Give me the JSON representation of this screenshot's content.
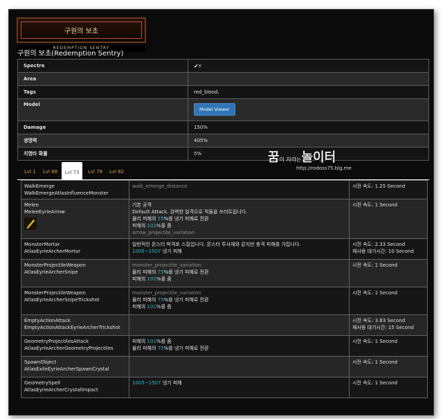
{
  "banner": {
    "title": "구원의 보초",
    "subtitle": "REDEMPTION SENTRY"
  },
  "page_title": "구원의 보초(Redemption Sentry)",
  "info_rows": [
    {
      "key": "Spectre",
      "value": "Y",
      "check": "✔"
    },
    {
      "key": "Area",
      "value": ""
    },
    {
      "key": "Tags",
      "value": "red_blood,"
    },
    {
      "key": "Model",
      "button": "Model Viewer"
    },
    {
      "key": "Damage",
      "value": "150%"
    },
    {
      "key": "생명력",
      "value": "405%"
    },
    {
      "key": "치명타 확률",
      "value": "5%"
    }
  ],
  "watermark": {
    "main_a": "꿈",
    "small_a": "이 자라는",
    "main_b": "놀이터",
    "url": "http://rodoss75.blg.me"
  },
  "tabs": [
    "Lvl 1",
    "Lvl 68",
    "Lvl 73",
    "Lvl 78",
    "Lvl 82"
  ],
  "active_tab": "Lvl 73",
  "skills": [
    {
      "name1": "WalkEmerge",
      "name2": "WalkEmergeAtlasInfluenceMonster",
      "desc": [
        {
          "parts": [
            {
              "t": "walk_emerge_distance",
              "c": "muted"
            }
          ]
        }
      ],
      "stats": [
        "시전 속도: 1.25 Second"
      ]
    },
    {
      "name1": "Melee",
      "name2": "MeleeEyrieArrow",
      "icon": "gold-feather-icon",
      "desc": [
        {
          "parts": [
            {
              "t": "기본 공격"
            }
          ]
        },
        {
          "parts": [
            {
              "t": "Default Attack. 강력한 일격으로 적들을 쓰러트립니다."
            }
          ]
        },
        {
          "parts": [
            {
              "t": "물리 피해의 "
            },
            {
              "t": "75",
              "c": "cyan"
            },
            {
              "t": "%를 냉기 피해로 전환"
            }
          ]
        },
        {
          "parts": [
            {
              "t": "피해의 "
            },
            {
              "t": "101",
              "c": "cyan"
            },
            {
              "t": "%를 줌"
            }
          ]
        },
        {
          "parts": [
            {
              "t": "arrow_projectile_variation",
              "c": "muted"
            }
          ]
        }
      ],
      "stats": [
        "시전 속도: 1 Second"
      ]
    },
    {
      "name1": "MonsterMortar",
      "name2": "AtlasEyrieArcherMortar",
      "desc": [
        {
          "parts": [
            {
              "t": "일반적인 몬스터 박격포 스킬입니다. 몬스터 투사체와 같지만 충격 피해를 가집니다."
            }
          ]
        },
        {
          "parts": [
            {
              "t": "1005~1507",
              "c": "cyan"
            },
            {
              "t": " 냉기 피해"
            }
          ]
        }
      ],
      "stats": [
        "시전 속도: 2.33 Second",
        "재사용 대기시간: 10 Second"
      ]
    },
    {
      "name1": "MonsterProjectileWeapon",
      "name2": "AtlasEyrieArcherSnipe",
      "desc": [
        {
          "parts": [
            {
              "t": "monster_projectile_variation",
              "c": "muted"
            }
          ]
        },
        {
          "parts": [
            {
              "t": "물리 피해의 "
            },
            {
              "t": "75",
              "c": "cyan"
            },
            {
              "t": "%를 냉기 피해로 전환"
            }
          ]
        },
        {
          "parts": [
            {
              "t": "피해의 "
            },
            {
              "t": "101",
              "c": "cyan"
            },
            {
              "t": "%를 줌"
            }
          ]
        }
      ],
      "stats": [
        "시전 속도: 1 Second"
      ]
    },
    {
      "name1": "MonsterProjectileWeapon",
      "name2": "AtlasEyrieArcherSnipeTrickshot",
      "desc": [
        {
          "parts": [
            {
              "t": "monster_projectile_variation",
              "c": "muted"
            }
          ]
        },
        {
          "parts": [
            {
              "t": "물리 피해의 "
            },
            {
              "t": "75",
              "c": "cyan"
            },
            {
              "t": "%를 냉기 피해로 전환"
            }
          ]
        },
        {
          "parts": [
            {
              "t": "피해의 "
            },
            {
              "t": "101",
              "c": "cyan"
            },
            {
              "t": "%를 줌"
            }
          ]
        }
      ],
      "stats": [
        "시전 속도: 1 Second"
      ]
    },
    {
      "name1": "EmptyActionAttack",
      "name2": "EmptyActionAttackEyrieArcherTrickshot",
      "desc": [],
      "stats": [
        "시전 속도: 3.83 Second",
        "재사용 대기시간: 15 Second"
      ]
    },
    {
      "name1": "GeometryProjectilesAttack",
      "name2": "AtlasEyrieArcherGeometryProjectiles",
      "desc": [
        {
          "parts": [
            {
              "t": "피해의 "
            },
            {
              "t": "101",
              "c": "cyan"
            },
            {
              "t": "%를 줌"
            }
          ]
        },
        {
          "parts": [
            {
              "t": "물리 피해의 "
            },
            {
              "t": "75",
              "c": "cyan"
            },
            {
              "t": "%를 냉기 피해로 전환"
            }
          ]
        }
      ],
      "stats": [
        "시전 속도: 1 Second"
      ]
    },
    {
      "name1": "SpawnObject",
      "name2": "AtlasExileEyrieArcherSpawnCrystal",
      "desc": [],
      "stats": [
        "시전 속도: 1 Second"
      ]
    },
    {
      "name1": "GeometrySpell",
      "name2": "AtlasEyrieArcherCrystalImpact",
      "desc": [
        {
          "parts": [
            {
              "t": "1005~1507",
              "c": "cyan"
            },
            {
              "t": " 냉기 피해"
            }
          ]
        }
      ],
      "stats": [
        "시전 속도: 1 Second"
      ]
    }
  ]
}
